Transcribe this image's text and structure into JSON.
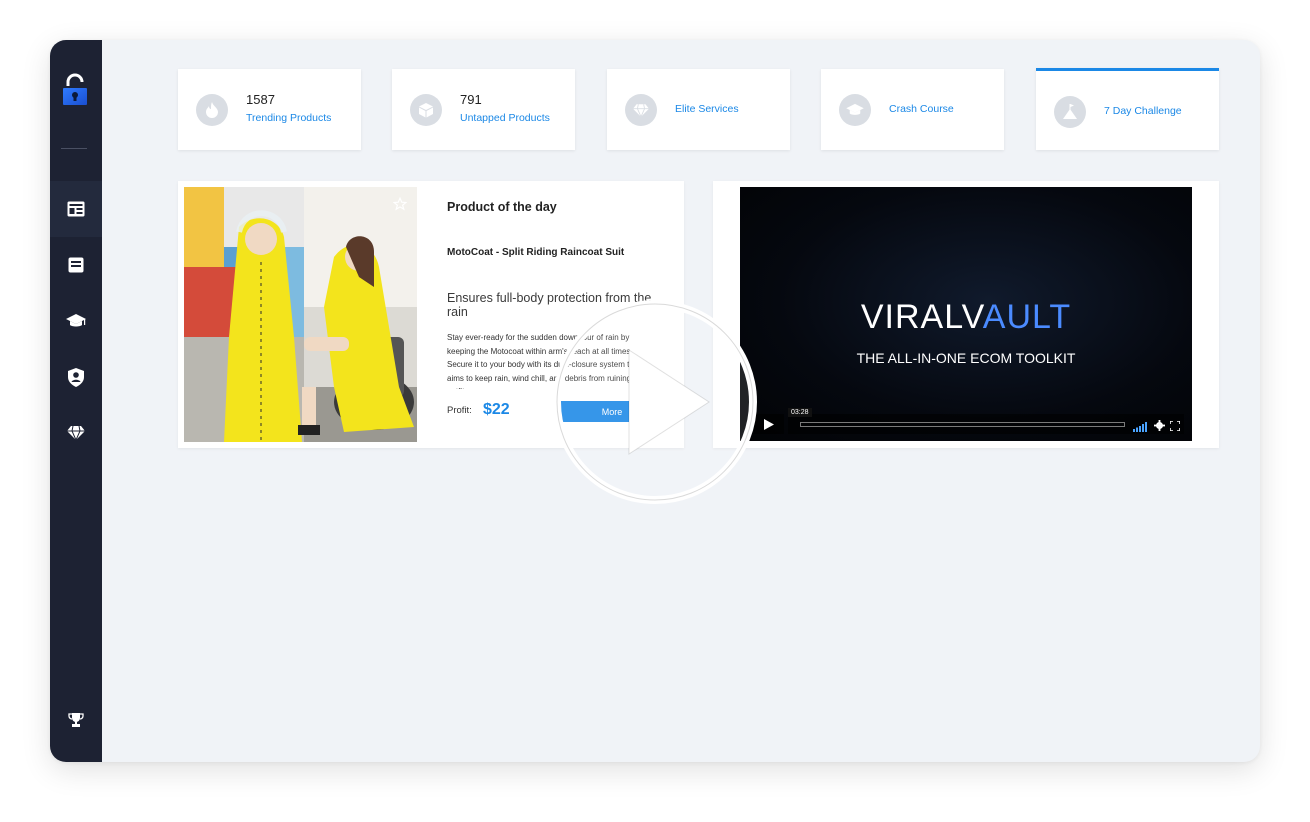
{
  "sidebar": {
    "items": [
      {
        "icon": "lock-open-icon"
      },
      {
        "icon": "dashboard-icon"
      },
      {
        "icon": "list-icon"
      },
      {
        "icon": "graduation-cap-icon"
      },
      {
        "icon": "user-shield-icon"
      },
      {
        "icon": "diamond-icon"
      },
      {
        "icon": "trophy-icon"
      }
    ]
  },
  "stats": [
    {
      "number": "1587",
      "label": "Trending Products",
      "icon": "fire-icon"
    },
    {
      "number": "791",
      "label": "Untapped Products",
      "icon": "box-icon"
    },
    {
      "label": "Elite Services",
      "icon": "diamond-icon"
    },
    {
      "label": "Crash Course",
      "icon": "graduation-cap-icon"
    },
    {
      "label": "7 Day Challenge",
      "icon": "mountain-icon"
    }
  ],
  "product": {
    "heading": "Product of the day",
    "name": "MotoCoat - Split Riding Raincoat Suit",
    "tagline": "Ensures full-body protection from the rain",
    "description": "Stay ever-ready for the sudden downpour of rain by keeping the Motocoat within arm's reach at all times. Secure it to your body with its dual-closure system that aims to keep rain, wind chill, and debris from ruining your outfit.",
    "profit_label": "Profit:",
    "profit_value": "$22",
    "more_label": "More"
  },
  "video": {
    "brand_left": "VIRALV",
    "brand_lock": "A",
    "brand_right": "ULT",
    "subtitle": "THE ALL-IN-ONE ECOM TOOLKIT",
    "time": "03:28"
  },
  "colors": {
    "accent": "#1b88e6",
    "sidebar": "#1d2233",
    "background": "#f0f3f7"
  }
}
